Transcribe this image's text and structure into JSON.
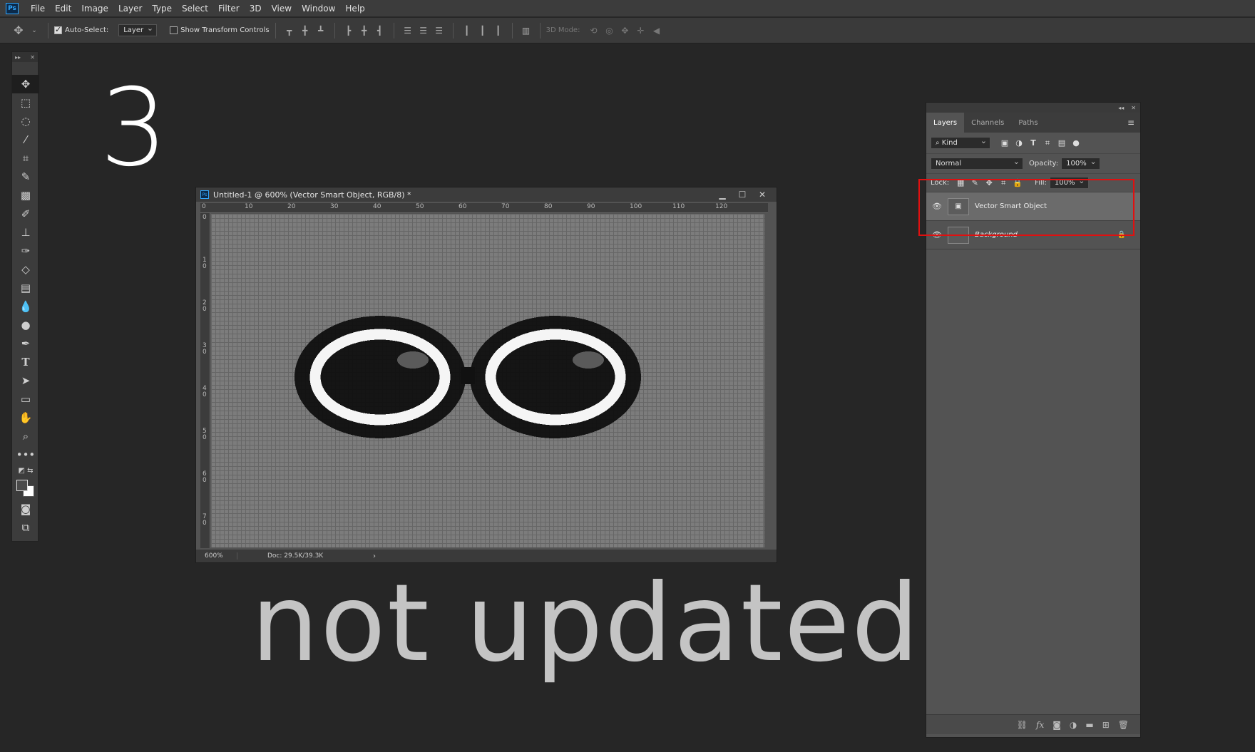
{
  "menubar": {
    "logo": "Ps",
    "items": [
      "File",
      "Edit",
      "Image",
      "Layer",
      "Type",
      "Select",
      "Filter",
      "3D",
      "View",
      "Window",
      "Help"
    ]
  },
  "options": {
    "auto_select_label": "Auto-Select:",
    "auto_select_value": "Layer",
    "show_transform_label": "Show Transform Controls",
    "mode_3d_label": "3D Mode:"
  },
  "overlay": {
    "number": "3",
    "caption": "not updated"
  },
  "document": {
    "title": "Untitled-1 @ 600% (Vector Smart Object, RGB/8) *",
    "zoom": "600%",
    "doc_info": "Doc: 29.5K/39.3K",
    "ruler_top": [
      "0",
      "10",
      "20",
      "30",
      "40",
      "50",
      "60",
      "70",
      "80",
      "90",
      "100",
      "110",
      "120"
    ],
    "ruler_left": [
      "0",
      "1 0",
      "2 0",
      "3 0",
      "4 0",
      "5 0",
      "6 0",
      "7 0"
    ]
  },
  "layers_panel": {
    "tabs": [
      "Layers",
      "Channels",
      "Paths"
    ],
    "filter_label": "Kind",
    "blend_mode": "Normal",
    "opacity_label": "Opacity:",
    "opacity_value": "100%",
    "lock_label": "Lock:",
    "fill_label": "Fill:",
    "fill_value": "100%",
    "layers": [
      {
        "name": "Vector Smart Object",
        "selected": true
      },
      {
        "name": "Background",
        "selected": false
      }
    ]
  },
  "colors": {
    "highlight": "#e01010",
    "accent": "#31a8ff"
  }
}
